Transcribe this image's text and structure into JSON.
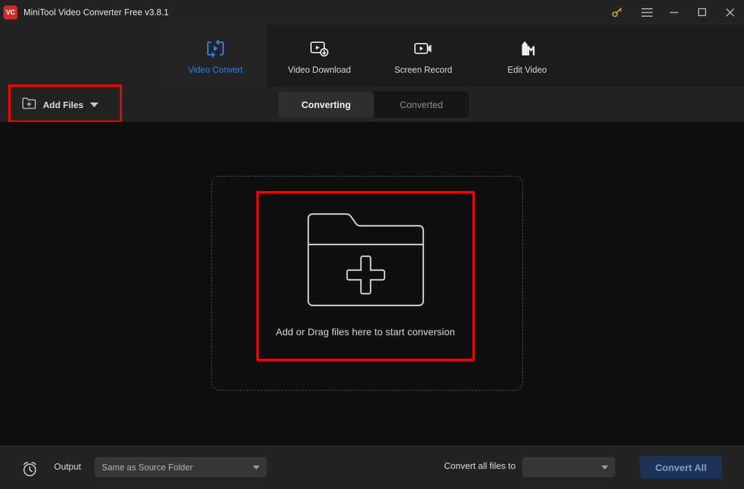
{
  "window": {
    "title": "MiniTool Video Converter Free v3.8.1",
    "logo_text": "VC",
    "logo_color": "#d42b22",
    "controls": [
      {
        "name": "key-icon",
        "label": ""
      },
      {
        "name": "menu-icon",
        "label": ""
      },
      {
        "name": "minimize-icon",
        "label": ""
      },
      {
        "name": "maximize-icon",
        "label": ""
      },
      {
        "name": "close-icon",
        "label": ""
      }
    ]
  },
  "nav": {
    "active_index": 0,
    "active_color": "#2f7fe8",
    "tabs": [
      {
        "label": "Video Convert",
        "icon": "convert-loop-icon"
      },
      {
        "label": "Video Download",
        "icon": "video-download-icon"
      },
      {
        "label": "Screen Record",
        "icon": "screen-record-icon"
      },
      {
        "label": "Edit Video",
        "icon": "edit-video-icon"
      }
    ]
  },
  "toolbar": {
    "add_files_label": "Add Files",
    "add_files_icon": "folder-plus-icon",
    "segments": [
      {
        "label": "Converting",
        "active": true
      },
      {
        "label": "Converted",
        "active": false
      }
    ]
  },
  "dropzone": {
    "text": "Add or Drag files here to start conversion",
    "icon": "folder-plus-large-icon"
  },
  "bottom": {
    "clock_icon": "alarm-clock-icon",
    "output_label": "Output",
    "output_value": "Same as Source Folder",
    "convert_all_files_to_label": "Convert all files to",
    "format_value": "",
    "convert_all_label": "Convert All",
    "convert_all_color": "#1b3358"
  },
  "annotations": {
    "color": "#ff0000",
    "boxes": [
      {
        "target": "add-files-button"
      },
      {
        "target": "dropzone"
      }
    ]
  }
}
